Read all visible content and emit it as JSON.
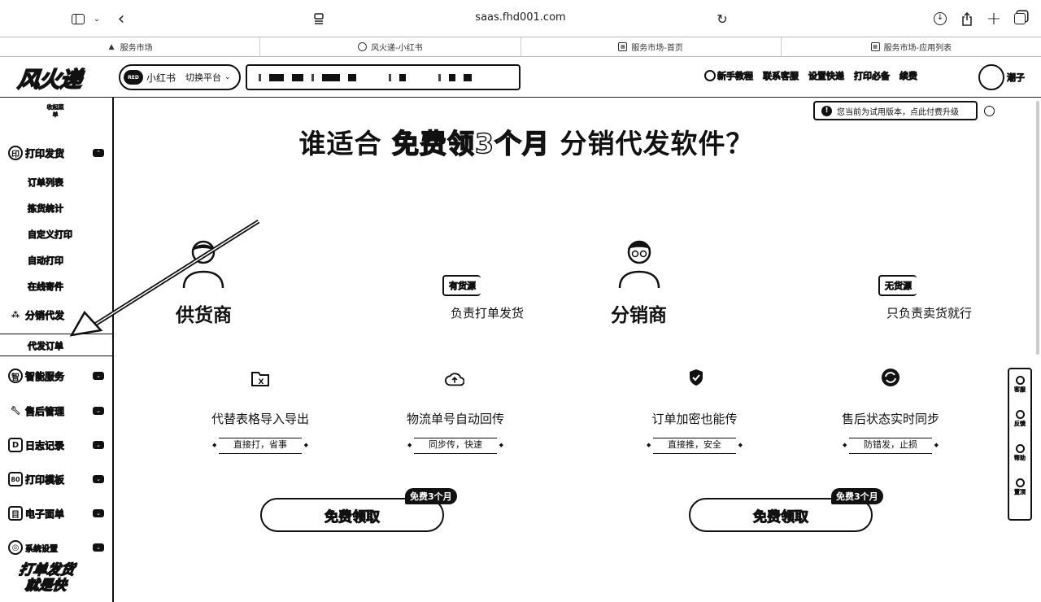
{
  "browser": {
    "url": "saas.fhd001.com",
    "tabs": [
      {
        "label": "服务市场",
        "icon": "triangle-icon"
      },
      {
        "label": "风火递-小红书",
        "icon": "round-logo-icon"
      },
      {
        "label": "服务市场-首页",
        "icon": "store-icon"
      },
      {
        "label": "服务市场-应用列表",
        "icon": "store-icon"
      }
    ]
  },
  "header": {
    "logo": "风火递",
    "platform": {
      "logo_text": "RED",
      "name": "小红书",
      "switch_label": "切换平台"
    },
    "nav": [
      "新手教程",
      "联系客服",
      "设置快递",
      "打印必备",
      "续费"
    ],
    "user": "潮子"
  },
  "sidebar": {
    "collapse": "收起菜单",
    "groups": [
      {
        "icon": "print-icon",
        "glyph": "印",
        "label": "打印发货"
      },
      {
        "icon": "share-icon",
        "glyph": "分",
        "label": "分销代发"
      },
      {
        "icon": "bulb-icon",
        "glyph": "智",
        "label": "智能服务"
      },
      {
        "icon": "wrench-icon",
        "glyph": "售",
        "label": "售后管理"
      },
      {
        "icon": "log-icon",
        "glyph": "D",
        "label": "日志记录"
      },
      {
        "icon": "template-icon",
        "glyph": "80",
        "label": "打印模板"
      },
      {
        "icon": "waybill-icon",
        "glyph": "目",
        "label": "电子面单"
      },
      {
        "icon": "more-icon",
        "glyph": "◎",
        "label": "系统设置"
      }
    ],
    "print_items": [
      "订单列表",
      "拣货统计",
      "自定义打印",
      "自动打印",
      "在线寄件"
    ],
    "dist_items": [
      "代发订单"
    ],
    "slogan_line1": "打单发货",
    "slogan_line2": "就是快"
  },
  "main": {
    "trial_notice": "您当前为试用版本，点此付费升级",
    "title_pre": "谁适合 ",
    "title_highlight": "免费领3个月",
    "title_post": " 分销代发软件？",
    "supplier": {
      "name": "供货商",
      "tag": "有货源",
      "desc": "负责打单发货"
    },
    "distributor": {
      "name": "分销商",
      "tag": "无货源",
      "desc": "只负责卖货就行"
    },
    "features": [
      {
        "icon": "excel-icon",
        "title": "代替表格导入导出",
        "tag": "直接打，省事"
      },
      {
        "icon": "cloud-upload-icon",
        "title": "物流单号自动回传",
        "tag": "同步传，快速"
      },
      {
        "icon": "shield-icon",
        "title": "订单加密也能传",
        "tag": "直接推，安全"
      },
      {
        "icon": "sync-icon",
        "title": "售后状态实时同步",
        "tag": "防错发，止损"
      }
    ],
    "claim_label": "免费领取",
    "claim_badge": "免费3个月"
  },
  "float_bar": [
    "客服",
    "反馈",
    "帮助",
    "置顶"
  ]
}
